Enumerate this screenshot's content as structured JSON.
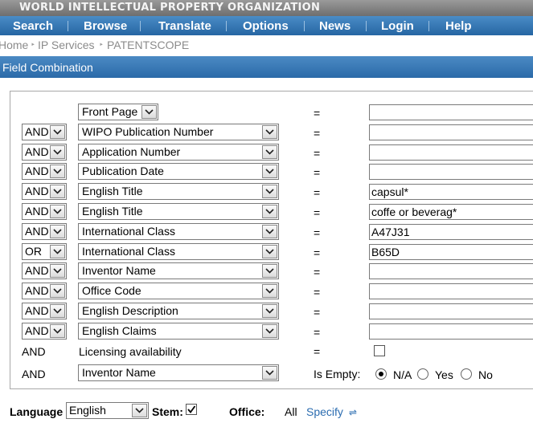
{
  "header": {
    "org_title": "WORLD INTELLECTUAL PROPERTY ORGANIZATION"
  },
  "nav": [
    "Search",
    "Browse",
    "Translate",
    "Options",
    "News",
    "Login",
    "Help"
  ],
  "breadcrumb": [
    "Home",
    "IP Services",
    "PATENTSCOPE"
  ],
  "section": {
    "title": "Field Combination"
  },
  "rows": [
    {
      "op": "",
      "field": "Front Page",
      "value": ""
    },
    {
      "op": "AND",
      "field": "WIPO Publication Number",
      "value": ""
    },
    {
      "op": "AND",
      "field": "Application Number",
      "value": ""
    },
    {
      "op": "AND",
      "field": "Publication Date",
      "value": ""
    },
    {
      "op": "AND",
      "field": "English Title",
      "value": "capsul*"
    },
    {
      "op": "AND",
      "field": "English Title",
      "value": "coffe or beverag*"
    },
    {
      "op": "AND",
      "field": "International Class",
      "value": "A47J31"
    },
    {
      "op": "OR",
      "field": "International Class",
      "value": "B65D"
    },
    {
      "op": "AND",
      "field": "Inventor Name",
      "value": ""
    },
    {
      "op": "AND",
      "field": "Office Code",
      "value": ""
    },
    {
      "op": "AND",
      "field": "English Description",
      "value": ""
    },
    {
      "op": "AND",
      "field": "English Claims",
      "value": ""
    }
  ],
  "equals_sign": "=",
  "licensing": {
    "op": "AND",
    "label": "Licensing availability",
    "checked": false
  },
  "empty_row": {
    "op": "AND",
    "field": "Inventor Name",
    "label": "Is Empty:",
    "options": [
      "N/A",
      "Yes",
      "No"
    ],
    "selected": "N/A"
  },
  "footer": {
    "language_label": "Language",
    "language_value": "English",
    "stem_label": "Stem:",
    "stem_checked": true,
    "office_label": "Office:",
    "office_value": "All",
    "specify_label": "Specify"
  }
}
